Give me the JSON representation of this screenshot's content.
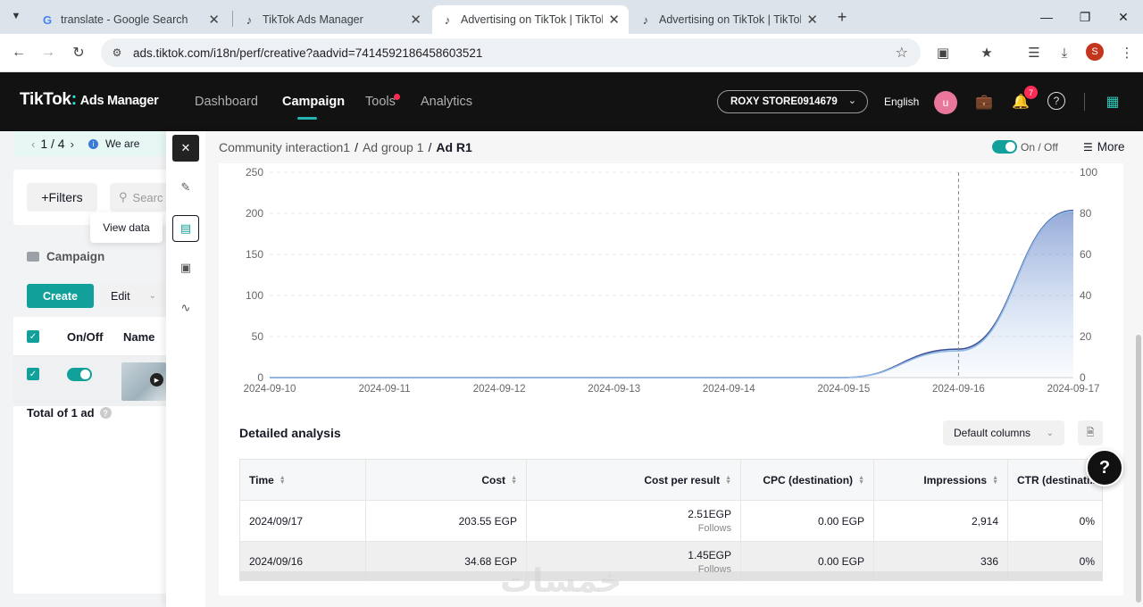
{
  "browser": {
    "tabs": [
      {
        "title": "translate - Google Search",
        "favicon": "google-icon",
        "active": false
      },
      {
        "title": "TikTok Ads Manager",
        "favicon": "tiktok-icon",
        "active": false
      },
      {
        "title": "Advertising on TikTok | TikTok A",
        "favicon": "tiktok-icon",
        "active": true
      },
      {
        "title": "Advertising on TikTok | TikTok A",
        "favicon": "tiktok-icon",
        "active": false
      }
    ],
    "url": "ads.tiktok.com/i18n/perf/creative?aadvid=7414592186458603521",
    "profile_initial": "S"
  },
  "header": {
    "logo": "TikTok",
    "logo_suffix": "Ads Manager",
    "nav": [
      "Dashboard",
      "Campaign",
      "Tools",
      "Analytics"
    ],
    "active_nav": "Campaign",
    "account": "ROXY STORE0914679",
    "language": "English",
    "avatar_initial": "u",
    "notification_count": "7"
  },
  "left_panel": {
    "pager": "1 / 4",
    "announcement": "We are",
    "filters_label": "Filters",
    "search_placeholder": "Searc",
    "tooltip": "View data",
    "section_label": "Campaign",
    "create_label": "Create",
    "edit_label": "Edit",
    "columns": [
      "On/Off",
      "Name"
    ],
    "total_label": "Total of 1 ad"
  },
  "drawer": {
    "breadcrumb": [
      "Community interaction1",
      "Ad group 1",
      "Ad R1"
    ],
    "onoff_label": "On / Off",
    "more_label": "More",
    "detail_title": "Detailed analysis",
    "columns_select": "Default columns",
    "table": {
      "headers": [
        "Time",
        "Cost",
        "Cost per result",
        "CPC (destination)",
        "Impressions",
        "CTR (destinati..."
      ],
      "rows": [
        {
          "time": "2024/09/17",
          "cost": "203.55 EGP",
          "cpr": "2.51EGP",
          "cpr_sub": "Follows",
          "cpc": "0.00 EGP",
          "impressions": "2,914",
          "ctr": "0%"
        },
        {
          "time": "2024/09/16",
          "cost": "34.68 EGP",
          "cpr": "1.45EGP",
          "cpr_sub": "Follows",
          "cpc": "0.00 EGP",
          "impressions": "336",
          "ctr": "0%"
        }
      ]
    }
  },
  "chart_data": {
    "type": "line",
    "x": [
      "2024-09-10",
      "2024-09-11",
      "2024-09-12",
      "2024-09-13",
      "2024-09-14",
      "2024-09-15",
      "2024-09-16",
      "2024-09-17"
    ],
    "y_left_ticks": [
      0,
      50,
      100,
      150,
      200,
      250
    ],
    "y_right_ticks": [
      0,
      20,
      40,
      60,
      80,
      100
    ],
    "ylim_left": [
      0,
      250
    ],
    "ylim_right": [
      0,
      100
    ],
    "grid": true,
    "series": [
      {
        "axis": "left",
        "color": "#3d4f94",
        "values": [
          0,
          0,
          0,
          0,
          0,
          0,
          34.68,
          203.55
        ]
      },
      {
        "axis": "right",
        "color": "#8fb9e6",
        "values": [
          0,
          0,
          0,
          0,
          0,
          0,
          13,
          81
        ],
        "area": true
      }
    ],
    "hover_x": "2024-09-16"
  },
  "watermark": "خمسات"
}
